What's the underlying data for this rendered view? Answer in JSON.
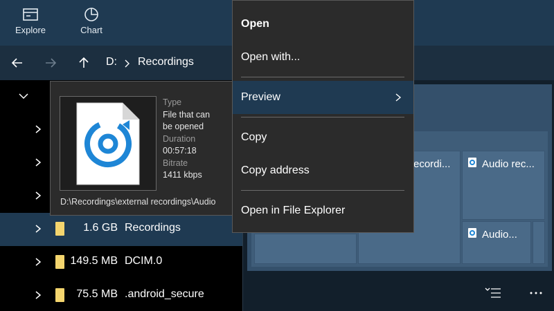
{
  "toolbar": {
    "explore_label": "Explore",
    "chart_label": "Chart"
  },
  "address": {
    "drive": "D:",
    "folder": "Recordings"
  },
  "tree": {
    "rows": [
      {
        "size": "",
        "name": ""
      },
      {
        "size": "",
        "name": ""
      },
      {
        "size": "",
        "name": ""
      },
      {
        "size": "1.6 GB",
        "name": "Recordings"
      },
      {
        "size": "149.5 MB",
        "name": "DCIM.0"
      },
      {
        "size": "75.5 MB",
        "name": ".android_secure"
      }
    ]
  },
  "preview_card": {
    "type_key": "Type",
    "type_value_1": "File that can",
    "type_value_2": "be opened",
    "duration_key": "Duration",
    "duration_value": "00:57:18",
    "bitrate_key": "Bitrate",
    "bitrate_value": "1411 kbps",
    "path": "D:\\Recordings\\external recordings\\Audio"
  },
  "context_menu": {
    "open": "Open",
    "open_with": "Open with...",
    "preview": "Preview",
    "copy": "Copy",
    "copy_address": "Copy address",
    "open_in_explorer": "Open in File Explorer"
  },
  "treemap": {
    "label_partial": "ecordi...",
    "label_audio_rec": "Audio rec...",
    "label_audio": "Audio..."
  },
  "colors": {
    "accent": "#1f3a52",
    "folder": "#f4d56e",
    "audio_icon": "#1e86d6"
  }
}
